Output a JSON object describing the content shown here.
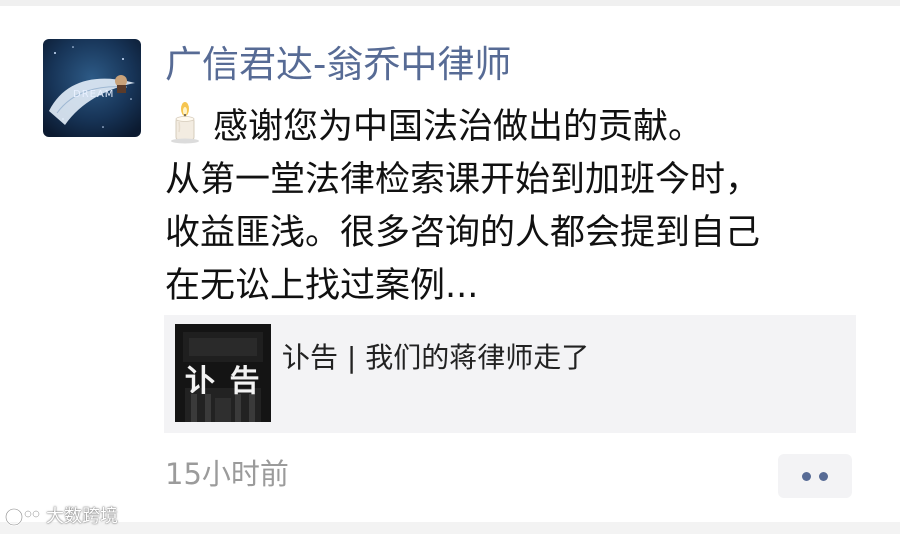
{
  "post": {
    "author": "广信君达-翁乔中律师",
    "avatar_text": "DREAM",
    "body_lines": [
      "感谢您为中国法治做出的贡献。",
      "从第一堂法律检索课开始到加班今时，",
      "收益匪浅。很多咨询的人都会提到自己",
      "在无讼上找过案例..."
    ],
    "body_icon": "candle-icon",
    "link_card": {
      "thumb_text": "讣 告",
      "title": "讣告 | 我们的蒋律师走了"
    },
    "timestamp": "15小时前",
    "more_icon": "more-dots-icon"
  },
  "watermark": {
    "text": "大数跨境",
    "logo_icon": "brand-logo-icon"
  },
  "colors": {
    "author_link": "#576b95",
    "body_text": "#111111",
    "meta_text": "#9b9b9b",
    "card_bg": "#f3f3f5"
  }
}
